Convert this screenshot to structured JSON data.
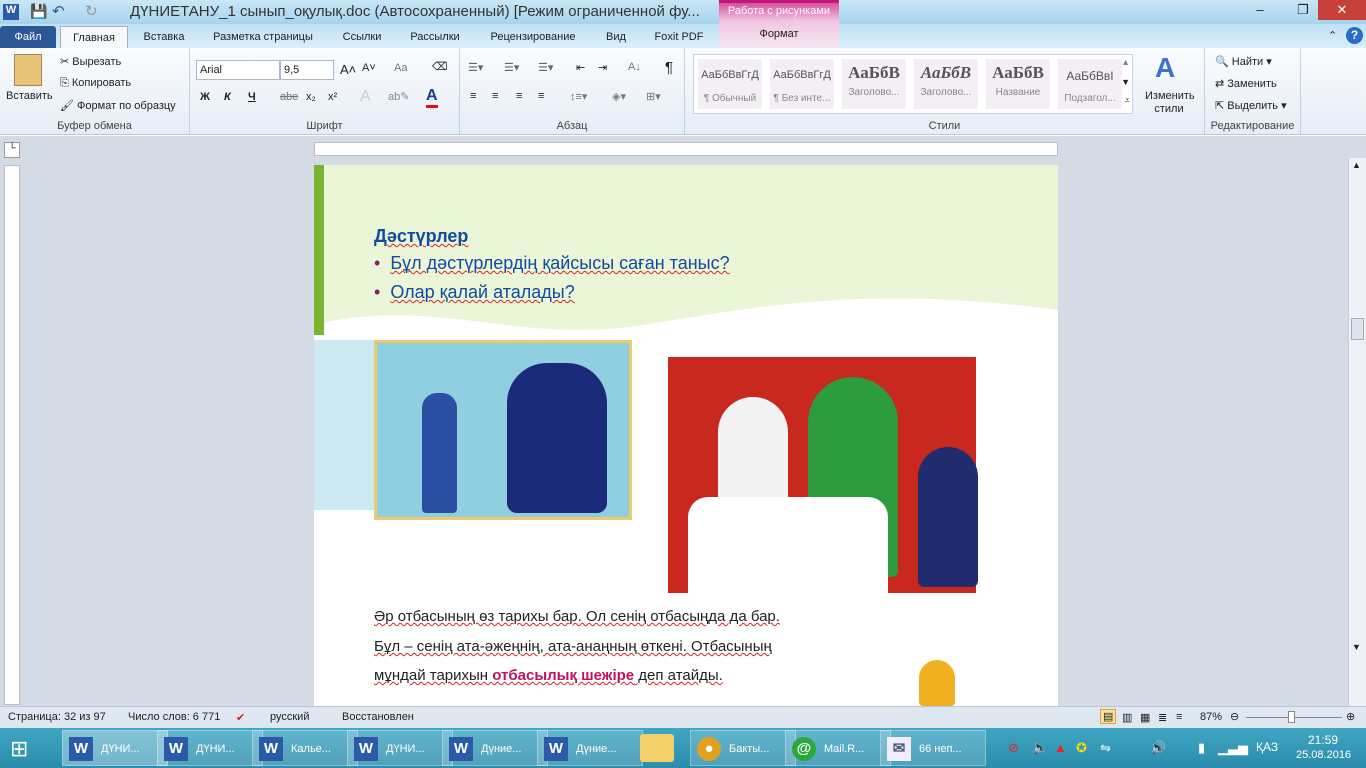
{
  "window": {
    "title": "ДҮНИЕТАНУ_1 сынып_оқулық.doc (Автосохраненный) [Режим ограниченной фу...",
    "context_tab_group": "Работа с рисунками",
    "minimize": "–",
    "restore": "❐",
    "close": "✕"
  },
  "tabs": [
    "Файл",
    "Главная",
    "Вставка",
    "Разметка страницы",
    "Ссылки",
    "Рассылки",
    "Рецензирование",
    "Вид",
    "Foxit PDF",
    "Формат"
  ],
  "ribbon": {
    "clipboard": {
      "label": "Буфер обмена",
      "paste": "Вставить",
      "cut": "Вырезать",
      "copy": "Копировать",
      "format_painter": "Формат по образцу"
    },
    "font": {
      "label": "Шрифт",
      "font_name": "Arial",
      "font_size": "9,5",
      "bold": "Ж",
      "italic": "К",
      "underline": "Ч",
      "strike": "abe",
      "sub": "x₂",
      "sup": "x²",
      "grow": "A˄",
      "shrink": "A˅",
      "case": "Aa",
      "color": "A",
      "font_color": "#e01010"
    },
    "paragraph": {
      "label": "Абзац",
      "pilcrow": "¶"
    },
    "styles": {
      "label": "Стили",
      "items": [
        {
          "sample": "АаБбВвГгД",
          "name": "¶ Обычный"
        },
        {
          "sample": "АаБбВвГгД",
          "name": "¶ Без инте..."
        },
        {
          "sample": "АаБбВ",
          "name": "Заголово..."
        },
        {
          "sample": "АаБбВ",
          "name": "Заголово..."
        },
        {
          "sample": "АаБбВ",
          "name": "Название"
        },
        {
          "sample": "АаБбВвI",
          "name": "Подзагол..."
        }
      ],
      "change": "Изменить стили"
    },
    "editing": {
      "label": "Редактирование",
      "find": "Найти",
      "replace": "Заменить",
      "select": "Выделить"
    }
  },
  "document": {
    "heading": "Дәстүрлер",
    "questions": [
      "Бұл дәстүрлердің қайсысы саған таныс?",
      "Олар қалай аталады?"
    ],
    "para": {
      "line1": "Әр отбасының өз тарихы бар. Ол сенің отбасыңда да бар.",
      "line2": "Бұл – сенің ата-әжеңнің,  ата-анаңның өткені. Отбасының",
      "line3_a": "мұндай тарихын ",
      "line3_hl": "отбасылық шежіре",
      "line3_b": " деп атайды."
    }
  },
  "status": {
    "page": "Страница: 32 из 97",
    "words": "Число слов: 6 771",
    "lang": "русский",
    "state": "Восстановлен",
    "zoom": "87%",
    "zoom_level": 87
  },
  "taskbar": {
    "items": [
      "ДҮНИ...",
      "ДҮНИ...",
      "Калье...",
      "ДҮНИ...",
      "Дүние...",
      "Дүние...",
      "",
      "Бакты...",
      "Mail.R...",
      "66 неп..."
    ],
    "lang": "ҚАЗ",
    "time": "21:59",
    "date": "25.08.2016"
  }
}
